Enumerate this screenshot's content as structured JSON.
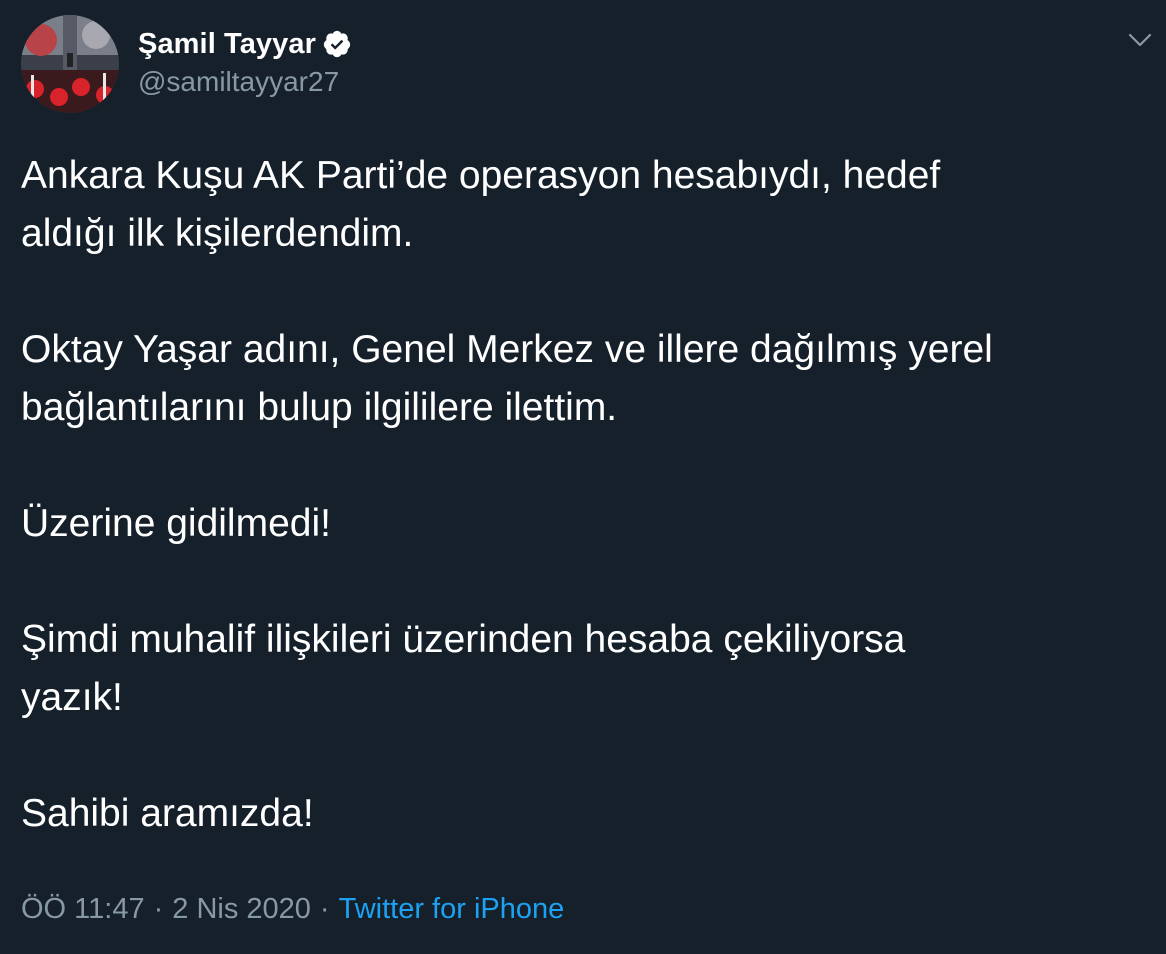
{
  "tweet": {
    "author": {
      "display_name": "Şamil Tayyar",
      "handle": "@samiltayyar27",
      "verified": true,
      "avatar_icon": "profile-avatar"
    },
    "menu_icon": "chevron-down-icon",
    "paragraphs": [
      "Ankara Kuşu AK Parti’de operasyon hesabıydı, hedef\naldığı ilk kişilerdendim.",
      "Oktay Yaşar adını, Genel Merkez ve illere dağılmış yerel\nbağlantılarını bulup ilgililere ilettim.",
      "Üzerine gidilmedi!",
      "Şimdi muhalif ilişkileri üzerinden hesaba çekiliyorsa\nyazık!",
      "Sahibi aramızda!"
    ],
    "time": "ÖÖ 11:47",
    "separator": "·",
    "date": "2 Nis 2020",
    "source": "Twitter for iPhone"
  },
  "colors": {
    "background": "#15202b",
    "text": "#ffffff",
    "secondary_text": "#8899a6",
    "link": "#1da1f2"
  }
}
